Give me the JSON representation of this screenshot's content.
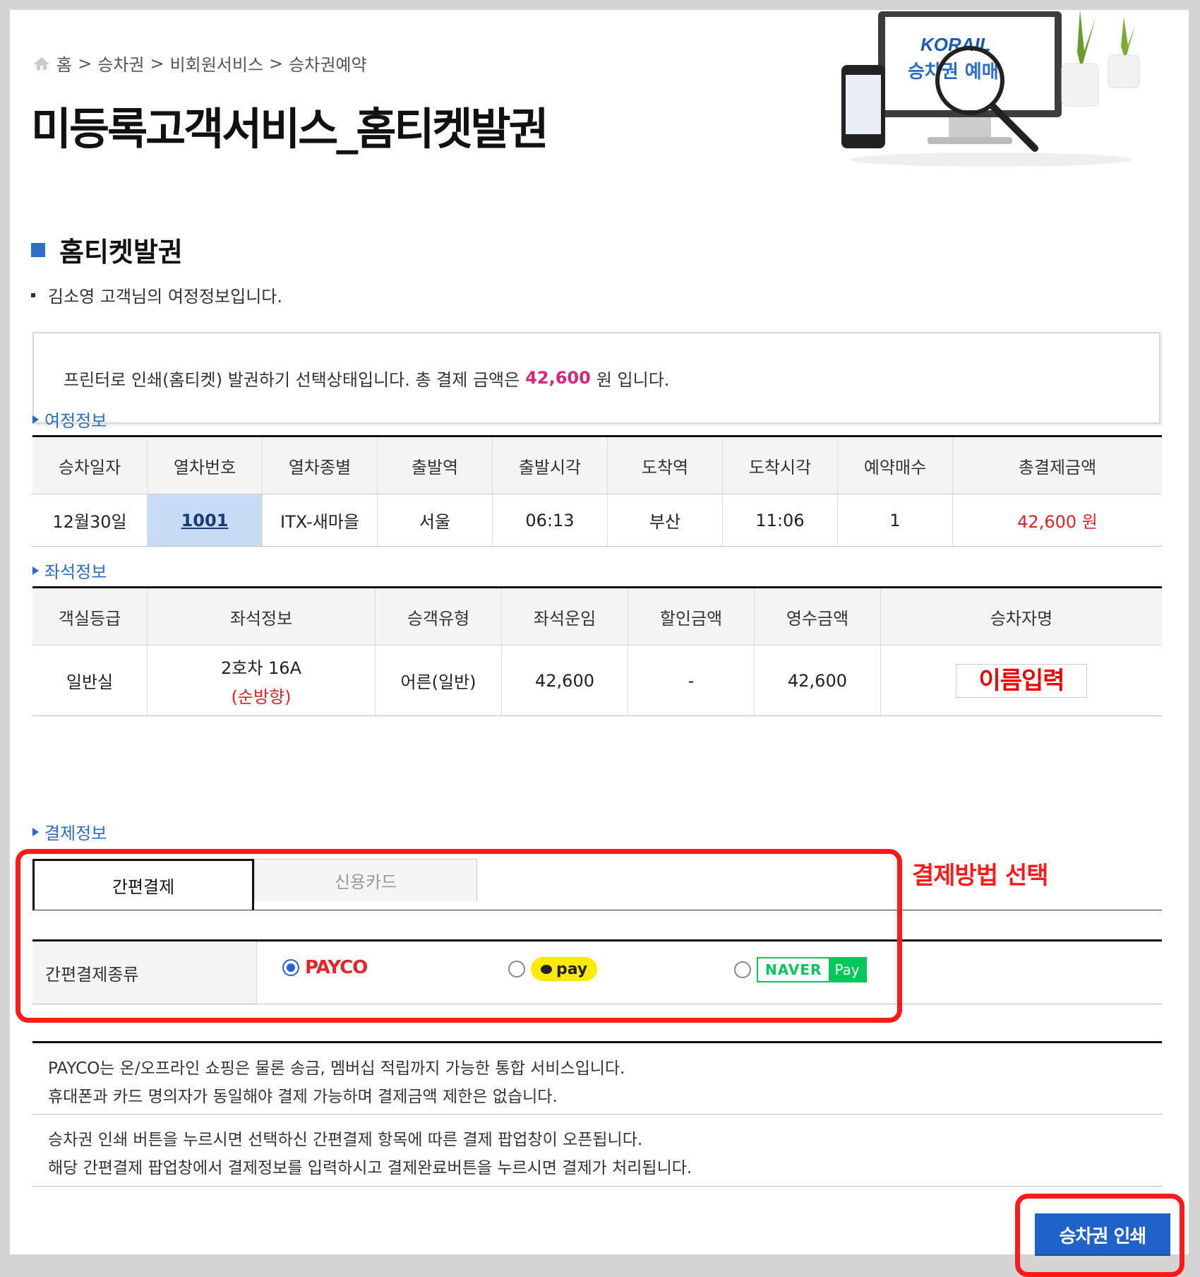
{
  "breadcrumb": {
    "items": [
      "홈",
      "승차권",
      "비회원서비스",
      "승차권예약"
    ],
    "sep": ">"
  },
  "page_title": "미등록고객서비스_홈티켓발권",
  "banner": {
    "logo": "KORAIL",
    "text": "승차권 예매"
  },
  "section": {
    "title": "홈티켓발권",
    "info_line": "김소영 고객님의 여정정보입니다."
  },
  "notice": {
    "prefix": "프린터로 인쇄(홈티켓) 발권하기 선택상태입니다. 총 결제 금액은",
    "amount": "42,600",
    "suffix": "원 입니다."
  },
  "trip": {
    "title": "여정정보",
    "headers": [
      "승차일자",
      "열차번호",
      "열차종별",
      "출발역",
      "출발시각",
      "도착역",
      "도착시각",
      "예약매수",
      "총결제금액"
    ],
    "row": [
      "12월30일",
      "1001",
      "ITX-새마을",
      "서울",
      "06:13",
      "부산",
      "11:06",
      "1",
      "42,600 원"
    ]
  },
  "seat": {
    "title": "좌석정보",
    "headers": [
      "객실등급",
      "좌석정보",
      "승객유형",
      "좌석운임",
      "할인금액",
      "영수금액",
      "승차자명"
    ],
    "class": "일반실",
    "seat_no": "2호차 16A",
    "direction": "(순방향)",
    "passenger": "어른(일반)",
    "fare": "42,600",
    "discount": "-",
    "paid": "42,600",
    "name_placeholder": "이름입력"
  },
  "payment": {
    "title": "결제정보",
    "tabs": [
      "간편결제",
      "신용카드"
    ],
    "active_tab": "간편결제",
    "type_label": "간편결제종류",
    "options": [
      {
        "name": "PAYCO",
        "selected": true
      },
      {
        "name": "pay",
        "brand": "kakao",
        "selected": false
      },
      {
        "name": "NAVER",
        "suffix": "Pay",
        "selected": false
      }
    ],
    "annotation": "결제방법 선택"
  },
  "descriptions": [
    [
      "PAYCO는 온/오프라인 쇼핑은 물론 송금, 멤버십 적립까지 가능한 통합 서비스입니다.",
      "휴대폰과 카드 명의자가 동일해야 결제 가능하며 결제금액 제한은 없습니다."
    ],
    [
      "승차권 인쇄 버튼을 누르시면 선택하신 간편결제 항목에 따른 결제 팝업창이 오픈됩니다.",
      "해당 간편결제 팝업창에서 결제정보를 입력하시고 결제완료버튼을 누르시면 결제가 처리됩니다."
    ]
  ],
  "print_button": "승차권 인쇄",
  "colors": {
    "accent_blue": "#1f63c8",
    "red": "#e02323",
    "amount_pink": "#d6257a",
    "annotation_red": "#ff1a1a"
  }
}
